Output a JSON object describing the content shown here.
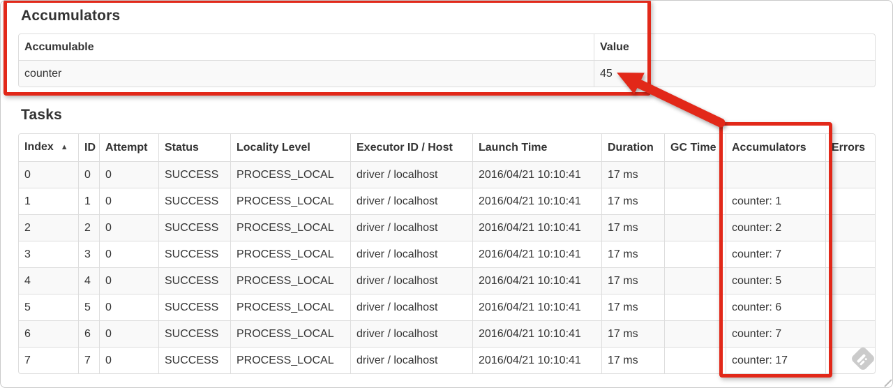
{
  "accumulators_section": {
    "title": "Accumulators",
    "table": {
      "col_accumulable": "Accumulable",
      "col_value": "Value",
      "rows": [
        {
          "accumulable": "counter",
          "value": "45"
        }
      ]
    }
  },
  "tasks_section": {
    "title": "Tasks",
    "table": {
      "headers": [
        "Index",
        "ID",
        "Attempt",
        "Status",
        "Locality Level",
        "Executor ID / Host",
        "Launch Time",
        "Duration",
        "GC Time",
        "Accumulators",
        "Errors"
      ],
      "sort_ascending_icon": "▲",
      "rows": [
        {
          "index": "0",
          "id": "0",
          "attempt": "0",
          "status": "SUCCESS",
          "locality_level": "PROCESS_LOCAL",
          "executor_id_host": "driver / localhost",
          "launch_time": "2016/04/21 10:10:41",
          "duration": "17 ms",
          "gc_time": "",
          "accumulators": "",
          "errors": ""
        },
        {
          "index": "1",
          "id": "1",
          "attempt": "0",
          "status": "SUCCESS",
          "locality_level": "PROCESS_LOCAL",
          "executor_id_host": "driver / localhost",
          "launch_time": "2016/04/21 10:10:41",
          "duration": "17 ms",
          "gc_time": "",
          "accumulators": "counter: 1",
          "errors": ""
        },
        {
          "index": "2",
          "id": "2",
          "attempt": "0",
          "status": "SUCCESS",
          "locality_level": "PROCESS_LOCAL",
          "executor_id_host": "driver / localhost",
          "launch_time": "2016/04/21 10:10:41",
          "duration": "17 ms",
          "gc_time": "",
          "accumulators": "counter: 2",
          "errors": ""
        },
        {
          "index": "3",
          "id": "3",
          "attempt": "0",
          "status": "SUCCESS",
          "locality_level": "PROCESS_LOCAL",
          "executor_id_host": "driver / localhost",
          "launch_time": "2016/04/21 10:10:41",
          "duration": "17 ms",
          "gc_time": "",
          "accumulators": "counter: 7",
          "errors": ""
        },
        {
          "index": "4",
          "id": "4",
          "attempt": "0",
          "status": "SUCCESS",
          "locality_level": "PROCESS_LOCAL",
          "executor_id_host": "driver / localhost",
          "launch_time": "2016/04/21 10:10:41",
          "duration": "17 ms",
          "gc_time": "",
          "accumulators": "counter: 5",
          "errors": ""
        },
        {
          "index": "5",
          "id": "5",
          "attempt": "0",
          "status": "SUCCESS",
          "locality_level": "PROCESS_LOCAL",
          "executor_id_host": "driver / localhost",
          "launch_time": "2016/04/21 10:10:41",
          "duration": "17 ms",
          "gc_time": "",
          "accumulators": "counter: 6",
          "errors": ""
        },
        {
          "index": "6",
          "id": "6",
          "attempt": "0",
          "status": "SUCCESS",
          "locality_level": "PROCESS_LOCAL",
          "executor_id_host": "driver / localhost",
          "launch_time": "2016/04/21 10:10:41",
          "duration": "17 ms",
          "gc_time": "",
          "accumulators": "counter: 7",
          "errors": ""
        },
        {
          "index": "7",
          "id": "7",
          "attempt": "0",
          "status": "SUCCESS",
          "locality_level": "PROCESS_LOCAL",
          "executor_id_host": "driver / localhost",
          "launch_time": "2016/04/21 10:10:41",
          "duration": "17 ms",
          "gc_time": "",
          "accumulators": "counter: 17",
          "errors": ""
        }
      ]
    }
  },
  "annotations": {
    "red_color": "#e22819",
    "table_border_color": "#dddddd",
    "row_stripe_color": "#f9f9f9"
  }
}
